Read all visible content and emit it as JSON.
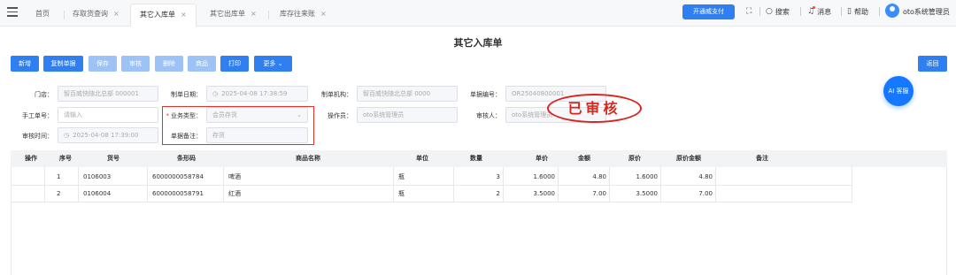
{
  "tabs": [
    {
      "label": "首页",
      "closable": false,
      "active": false
    },
    {
      "label": "存取货查询",
      "closable": true,
      "active": false
    },
    {
      "label": "其它入库单",
      "closable": true,
      "active": true
    },
    {
      "label": "其它出库单",
      "closable": true,
      "active": false
    },
    {
      "label": "库存往来账",
      "closable": true,
      "active": false
    }
  ],
  "close_glyph": "×",
  "header": {
    "open_button": "开通威支付",
    "search": "搜索",
    "messages": "消息",
    "help": "帮助",
    "user": "oto系统管理员"
  },
  "page": {
    "title": "其它入库单",
    "back": "返回",
    "ai": "AI 客服",
    "stamp": "已审核"
  },
  "toolbar": {
    "new": "新增",
    "copy": "复制单据",
    "save": "保存",
    "audit": "审核",
    "delete": "删除",
    "goods": "商品",
    "print": "打印",
    "more": "更多"
  },
  "form": {
    "store_label": "门店：",
    "store_value": "智百威快随北总部 000001",
    "date_label": "制单日期：",
    "date_value": "2025-04-08 17:38:59",
    "org_label": "制单机构：",
    "org_value": "智百威快随北总部 0000",
    "billno_label": "单据编号：",
    "billno_value": "OR25040800001",
    "manual_label": "手工单号：",
    "manual_placeholder": "请输入",
    "biztype_label": "业务类型：",
    "biztype_value": "会员存货",
    "operator_label": "操作员：",
    "operator_value": "oto系统管理员",
    "auditor_label": "审核人：",
    "auditor_value": "oto系统管理员",
    "audittime_label": "审核时间：",
    "audittime_value": "2025-04-08 17:39:00",
    "remark_label": "单据备注：",
    "remark_value": "存货"
  },
  "table": {
    "headers": [
      "操作",
      "序号",
      "货号",
      "条形码",
      "商品名称",
      "单位",
      "数量",
      "单价",
      "金额",
      "原价",
      "原价金额",
      "备注"
    ],
    "rows": [
      {
        "seq": "1",
        "code": "0106003",
        "barcode": "6000000058784",
        "name": "啤酒",
        "unit": "瓶",
        "qty": "3",
        "price": "1.6000",
        "amount": "4.80",
        "orig_price": "1.6000",
        "orig_amount": "4.80",
        "remark": ""
      },
      {
        "seq": "2",
        "code": "0106004",
        "barcode": "6000000058791",
        "name": "红酒",
        "unit": "瓶",
        "qty": "2",
        "price": "3.5000",
        "amount": "7.00",
        "orig_price": "3.5000",
        "orig_amount": "7.00",
        "remark": ""
      }
    ]
  },
  "colors": {
    "primary": "#2f7ff1",
    "disabled": "#9dc3f6",
    "stamp": "#d9261c",
    "highlight": "#e0342b"
  }
}
